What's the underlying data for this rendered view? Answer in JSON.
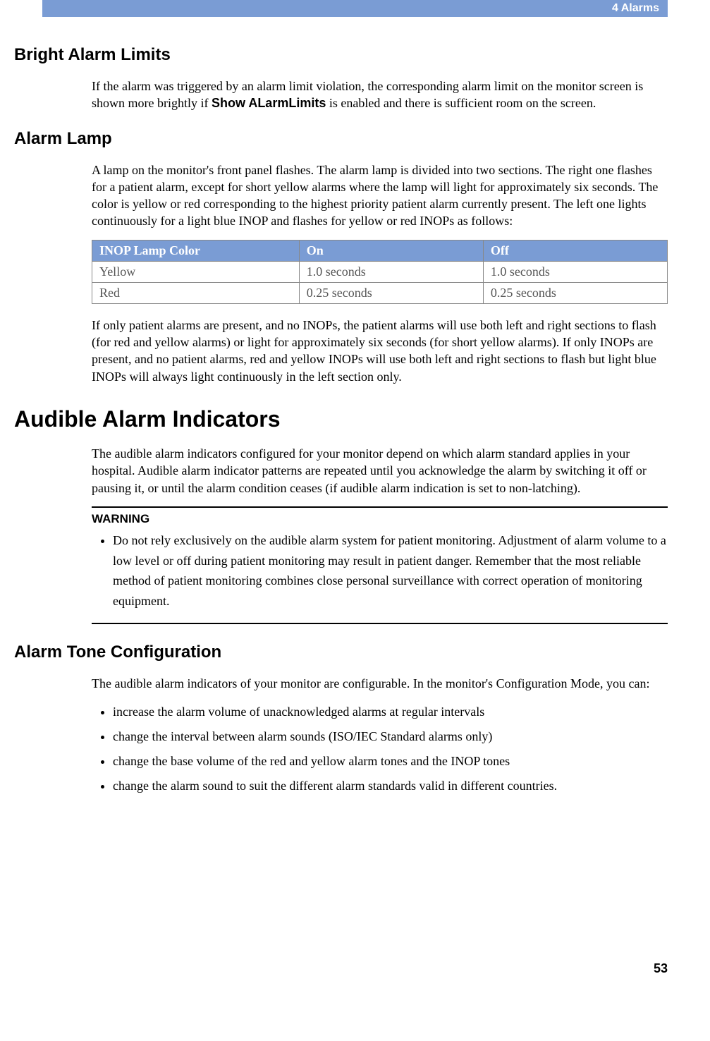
{
  "header": {
    "chapter": "4 Alarms"
  },
  "page_number": "53",
  "sections": {
    "bright_alarm_limits": {
      "title": "Bright Alarm Limits",
      "p1a": "If the alarm was triggered by an alarm limit violation, the corresponding alarm limit on the monitor screen is shown more brightly if ",
      "ui_label": "Show ALarmLimits",
      "p1b": " is enabled and there is sufficient room on the screen."
    },
    "alarm_lamp": {
      "title": "Alarm Lamp",
      "p1": "A lamp on the monitor's front panel flashes. The alarm lamp is divided into two sections. The right one flashes for a patient alarm, except for short yellow alarms where the lamp will light for approximately six seconds. The color is yellow or red corresponding to the highest priority patient alarm currently present. The left one lights continuously for a light blue INOP and flashes for yellow or red INOPs as follows:",
      "table": {
        "headers": {
          "c1": "INOP Lamp Color",
          "c2": "On",
          "c3": "Off"
        },
        "rows": [
          {
            "c1": "Yellow",
            "c2": "1.0 seconds",
            "c3": "1.0 seconds"
          },
          {
            "c1": "Red",
            "c2": "0.25 seconds",
            "c3": "0.25 seconds"
          }
        ]
      },
      "p2": "If only patient alarms are present, and no INOPs, the patient alarms will use both left and right sections to flash (for red and yellow alarms) or light for approximately six seconds (for short yellow alarms). If only INOPs are present, and no patient alarms, red and yellow INOPs will use both left and right sections to flash but light blue INOPs will always light continuously in the left section only."
    },
    "audible": {
      "title": "Audible Alarm Indicators",
      "p1": "The audible alarm indicators configured for your monitor depend on which alarm standard applies in your hospital. Audible alarm indicator patterns are repeated until you acknowledge the alarm by switching it off or pausing it, or until the alarm condition ceases (if audible alarm indication is set to non-latching).",
      "warning": {
        "label": "WARNING",
        "item": "Do not rely exclusively on the audible alarm system for patient monitoring. Adjustment of alarm volume to a low level or off during patient monitoring may result in patient danger. Remember that the most reliable method of patient monitoring combines close personal surveillance with correct operation of monitoring equipment."
      }
    },
    "tone_config": {
      "title": "Alarm Tone Configuration",
      "p1": "The audible alarm indicators of your monitor are configurable. In the monitor's Configuration Mode, you can:",
      "items": [
        "increase the alarm volume of unacknowledged alarms at regular intervals",
        "change the interval between alarm sounds (ISO/IEC Standard alarms only)",
        "change the base volume of the red and yellow alarm tones and the INOP tones",
        "change the alarm sound to suit the different alarm standards valid in different countries."
      ]
    }
  }
}
